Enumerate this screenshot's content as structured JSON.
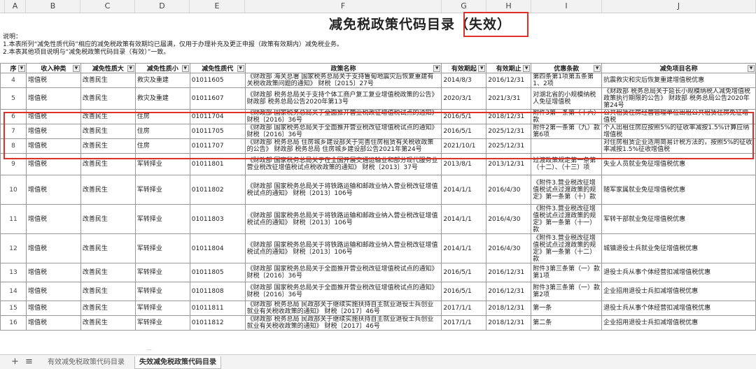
{
  "column_letters": [
    "A",
    "B",
    "C",
    "D",
    "E",
    "F",
    "G",
    "H",
    "I",
    "J"
  ],
  "title": {
    "main": "减免税政策代码目录",
    "suffix": "（失效）"
  },
  "notes": {
    "label": "说明：",
    "line1": "1.本表所列“减免性质代码”相应的减免税政策有效期均已届满，仅用于办理补充及更正申报（政策有效期内）减免税业务。",
    "line2": "2.本表其他项目说明与“减免税政策代码目录（有效）”一致。"
  },
  "table": {
    "headers": [
      "序",
      "收入种类",
      "减免性质大",
      "减免性质小",
      "减免性质代",
      "政策名称",
      "有效期起",
      "有效期止",
      "优惠条款",
      "减免项目名称"
    ],
    "rows": [
      {
        "idx": "4",
        "kind": "增值税",
        "big": "改善民生",
        "small": "救灾及重建",
        "code": "01011605",
        "policy": "《财政部 海关总署 国家税务总局关于支持鲁甸地震灾后恢复重建有关税收政策问题的通知》 财税〔2015〕27号",
        "start": "2014/8/3",
        "end": "2016/12/31",
        "clause": "第四条第1项第五条第1、2项",
        "item": "抗震救灾和灾后恢复重建增值税优惠"
      },
      {
        "idx": "5",
        "kind": "增值税",
        "big": "改善民生",
        "small": "救灾及重建",
        "code": "01011607",
        "policy": "《财政部 税务总局关于支持个体工商户复工复业增值税政策的公告》 财政部 税务总局公告2020年第13号",
        "start": "2020/3/1",
        "end": "2021/3/31",
        "clause": "对湖北省的小规模纳税人免征增值税",
        "item": "《财政部 税务总局关于延长小规模纳税人减免增值税政策执行期限的公告》 财政部 税务总局公告2020年第24号"
      },
      {
        "idx": "6",
        "kind": "增值税",
        "big": "改善民生",
        "small": "住房",
        "code": "01011704",
        "policy": "《财政部 国家税务总局关于全面推开营业税改征增值税试点的通知》 财税〔2016〕36号",
        "start": "2016/5/1",
        "end": "2018/12/31",
        "clause": "附件3第一条第（十六）款",
        "item": "公共租赁住房经营管理单位出租公共租赁住房免征增值税"
      },
      {
        "idx": "7",
        "kind": "增值税",
        "big": "改善民生",
        "small": "住房",
        "code": "01011705",
        "policy": "《财政部 国家税务总局关于全面推开营业税改征增值税试点的通知》 财税〔2016〕36号",
        "start": "2016/5/1",
        "end": "2025/12/31",
        "clause": "附件2第一条第（九）款第6项",
        "item": "个人出租住房应按照5%的征收率减按1.5%计算应纳增值税"
      },
      {
        "idx": "8",
        "kind": "增值税",
        "big": "改善民生",
        "small": "住房",
        "code": "01011707",
        "policy": "《财政部 税务总局 住房城乡建设部关于完善住房租赁有关税收政策的公告》 财政部 税务总局 住房城乡建设部公告2021年第24号",
        "start": "2021/10/1",
        "end": "2025/12/31",
        "clause": "",
        "item": "对住房租赁企业适用简易计税方法的，按照5%的征收率减按1.5%征收增值税"
      },
      {
        "idx": "9",
        "kind": "增值税",
        "big": "改善民生",
        "small": "军转择业",
        "code": "01011801",
        "policy": "《财政部 国家税务总局关于在全国开展交通运输业和部分现代服务业营业税改征增值税试点税收政策的通知》 财税〔2013〕37号",
        "start": "2013/8/1",
        "end": "2013/12/31",
        "clause": "过渡政策规定第一条第（十二）、（十三）项",
        "item": "失业人员就业免征增值税优惠"
      },
      {
        "idx": "10",
        "kind": "增值税",
        "big": "改善民生",
        "small": "军转择业",
        "code": "01011802",
        "policy": "《财政部 国家税务总局关于将铁路运输和邮政业纳入营业税改征增值税试点的通知》 财税〔2013〕106号",
        "start": "2014/1/1",
        "end": "2016/4/30",
        "clause": "《附件3.营业税改征增值税试点过渡政策的规定》第一条第（十）款",
        "item": "随军家属就业免征增值税优惠"
      },
      {
        "idx": "11",
        "kind": "增值税",
        "big": "改善民生",
        "small": "军转择业",
        "code": "01011803",
        "policy": "《财政部 国家税务总局关于将铁路运输和邮政业纳入营业税改征增值税试点的通知》 财税〔2013〕106号",
        "start": "2014/1/1",
        "end": "2016/4/30",
        "clause": "《附件3.营业税改征增值税试点过渡政策的规定》第一条第（十一）款",
        "item": "军转干部就业免征增值税优惠"
      },
      {
        "idx": "12",
        "kind": "增值税",
        "big": "改善民生",
        "small": "军转择业",
        "code": "01011804",
        "policy": "《财政部 国家税务总局关于将铁路运输和邮政业纳入营业税改征增值税试点的通知》 财税〔2013〕106号",
        "start": "2014/1/1",
        "end": "2016/4/30",
        "clause": "《附件3.营业税改征增值税试点过渡政策的规定》第一条第（十二）款",
        "item": "城镇退役士兵就业免征增值税优惠"
      },
      {
        "idx": "13",
        "kind": "增值税",
        "big": "改善民生",
        "small": "军转择业",
        "code": "01011805",
        "policy": "《财政部 国家税务总局关于全面推开营业税改征增值税试点的通知》 财税〔2016〕36号",
        "start": "2016/5/1",
        "end": "2016/12/31",
        "clause": "附件3第三条第（一）款第1项",
        "item": "退役士兵从事个体经营扣减增值税优惠"
      },
      {
        "idx": "14",
        "kind": "增值税",
        "big": "改善民生",
        "small": "军转择业",
        "code": "01011808",
        "policy": "《财政部 国家税务总局关于全面推开营业税改征增值税试点的通知》 财税〔2016〕36号",
        "start": "2016/5/1",
        "end": "2016/12/31",
        "clause": "附件3第三条第（一）款第2项",
        "item": "企业招用退役士兵扣减增值税优惠"
      },
      {
        "idx": "15",
        "kind": "增值税",
        "big": "改善民生",
        "small": "军转择业",
        "code": "01011811",
        "policy": "《财政部 税务总局 民政部关于继续实施扶持自主就业退役士兵创业就业有关税收政策的通知》 财税〔2017〕46号",
        "start": "2017/1/1",
        "end": "2018/12/31",
        "clause": "第一条",
        "item": "退役士兵从事个体经营扣减增值税优惠"
      },
      {
        "idx": "16",
        "kind": "增值税",
        "big": "改善民生",
        "small": "军转择业",
        "code": "01011812",
        "policy": "《财政部 税务总局 民政部关于继续实施扶持自主就业退役士兵创业就业有关税收政策的通知》 财税〔2017〕46号",
        "start": "2017/1/1",
        "end": "2018/12/31",
        "clause": "第二条",
        "item": "企业招用退役士兵扣减增值税优惠"
      }
    ]
  },
  "tabs": {
    "add": "+",
    "list": "≡",
    "tab1": "有效减免税政策代码目录",
    "tab2": "失效减免税政策代码目录"
  },
  "scroll_marker": "---"
}
